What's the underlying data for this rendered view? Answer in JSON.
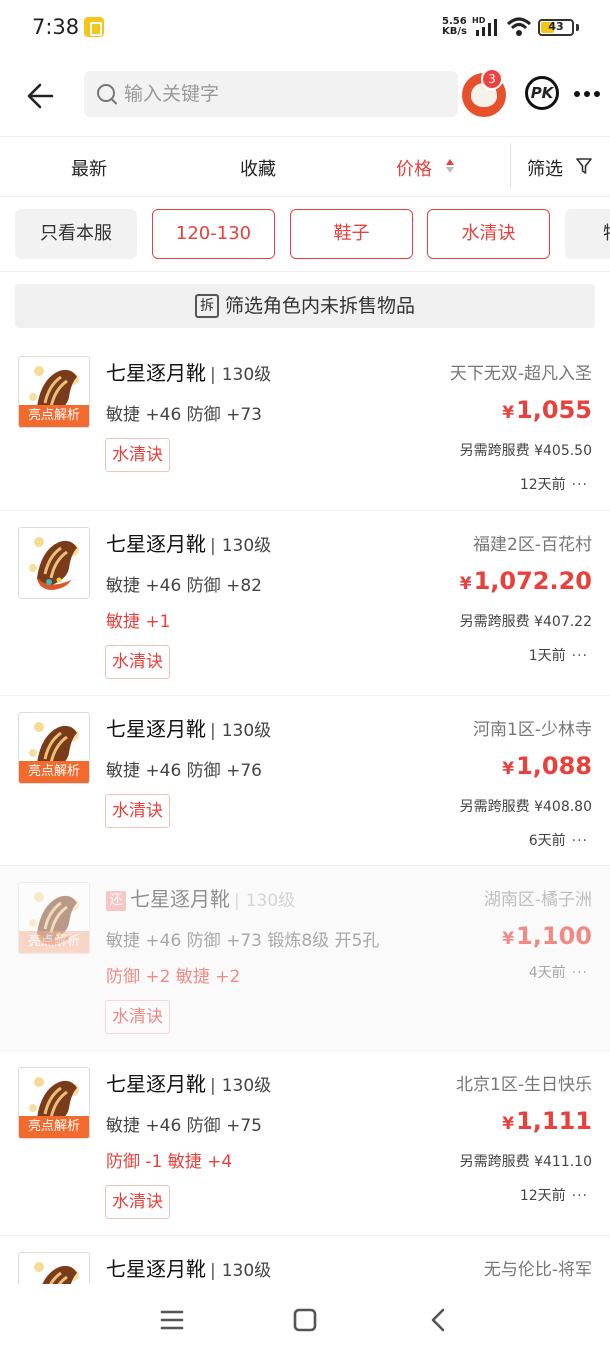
{
  "status_bar": {
    "time": "7:38",
    "net_speed_value": "5.56",
    "net_speed_unit": "KB/s",
    "hd": "HD",
    "battery": "43",
    "battery_level_percent": 43
  },
  "header": {
    "search_placeholder": "输入关键字",
    "avatar_badge": "3",
    "pk_label": "PK"
  },
  "sort": {
    "latest": "最新",
    "favorites": "收藏",
    "price": "价格",
    "filter": "筛选"
  },
  "chips": [
    "只看本服",
    "120-130",
    "鞋子",
    "水清诀",
    "特"
  ],
  "unsplit": {
    "icon_char": "拆",
    "label": "筛选角色内未拆售物品"
  },
  "listings": [
    {
      "name": "七星逐月靴",
      "level": "130级",
      "return_tag": "",
      "highlight": "亮点解析",
      "stats": "敏捷 +46 防御 +73",
      "bonus": "",
      "tag": "水清诀",
      "server": "天下无双-超凡入圣",
      "currency": "¥",
      "price": "1,055",
      "fee": "另需跨服费 ¥405.50",
      "time": "12天前",
      "more": "···"
    },
    {
      "name": "七星逐月靴",
      "level": "130级",
      "return_tag": "",
      "highlight": "",
      "stats": "敏捷 +46 防御 +82",
      "bonus": "敏捷 +1",
      "tag": "水清诀",
      "server": "福建2区-百花村",
      "currency": "¥",
      "price": "1,072.20",
      "fee": "另需跨服费 ¥407.22",
      "time": "1天前",
      "more": "···"
    },
    {
      "name": "七星逐月靴",
      "level": "130级",
      "return_tag": "",
      "highlight": "亮点解析",
      "stats": "敏捷 +46 防御 +76",
      "bonus": "",
      "tag": "水清诀",
      "server": "河南1区-少林寺",
      "currency": "¥",
      "price": "1,088",
      "fee": "另需跨服费 ¥408.80",
      "time": "6天前",
      "more": "···"
    },
    {
      "name": "七星逐月靴",
      "level": "130级",
      "return_tag": "还",
      "highlight": "亮点解析",
      "stats": "敏捷 +46 防御 +73 锻炼8级 开5孔",
      "bonus": "防御 +2 敏捷 +2",
      "tag": "水清诀",
      "server": "湖南区-橘子洲",
      "currency": "¥",
      "price": "1,100",
      "fee": "",
      "time": "4天前",
      "more": "···"
    },
    {
      "name": "七星逐月靴",
      "level": "130级",
      "return_tag": "",
      "highlight": "亮点解析",
      "stats": "敏捷 +46 防御 +75",
      "bonus": "防御 -1 敏捷 +4",
      "tag": "水清诀",
      "server": "北京1区-生日快乐",
      "currency": "¥",
      "price": "1,111",
      "fee": "另需跨服费 ¥411.10",
      "time": "12天前",
      "more": "···"
    },
    {
      "name": "七星逐月靴",
      "level": "130级",
      "return_tag": "",
      "highlight": "",
      "stats": "",
      "bonus": "",
      "tag": "",
      "server": "无与伦比-将军",
      "currency": "",
      "price": "",
      "fee": "",
      "time": "",
      "more": ""
    }
  ]
}
